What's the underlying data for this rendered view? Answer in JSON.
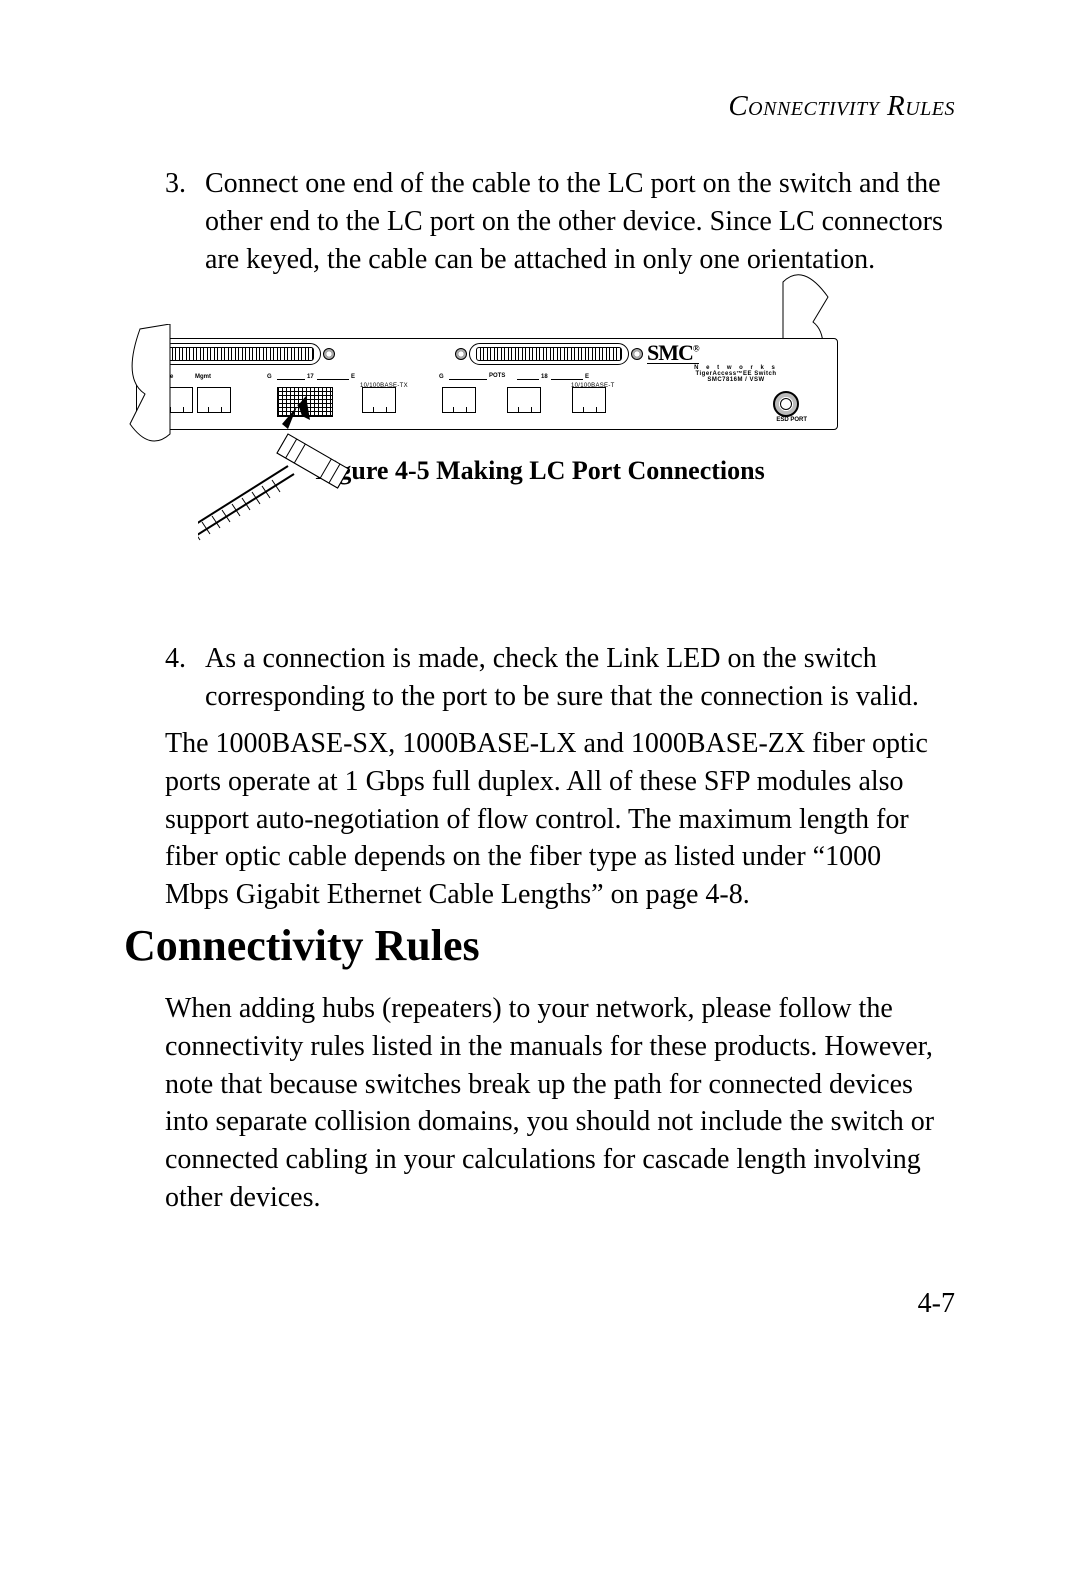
{
  "running_head": "Connectivity Rules",
  "items": {
    "3": {
      "num": "3.",
      "text": "Connect one end of the cable to the LC port on the switch and the other end to the LC port on the other device. Since LC connectors are keyed, the cable can be attached in only one orientation."
    },
    "4": {
      "num": "4.",
      "text": "As a connection is made, check the Link LED on the switch corresponding to the port to be sure that the connection is valid."
    }
  },
  "figure": {
    "caption": "Figure 4-5  Making LC Port Connections",
    "brand": {
      "logo": "SMC",
      "networks": "N e t w o r k s",
      "line3": "TigerAccess™EE Switch",
      "line4": "SMC7816M / VSW"
    },
    "labels": {
      "line": "Line",
      "mgmt": "Mgmt",
      "pots": "POTS",
      "g_left": "G",
      "g_right": "E",
      "num17": "17",
      "num18": "18",
      "esdport": "ESD PORT",
      "eth1": "10/100BASE-TX",
      "eth2": "10/100BASE-T"
    }
  },
  "paraSFP": "The 1000BASE-SX, 1000BASE-LX and 1000BASE-ZX fiber optic ports operate at 1 Gbps full duplex. All of these SFP modules also support auto-negotiation of flow control. The maximum length for fiber optic cable depends on the fiber type as listed under “1000 Mbps Gigabit Ethernet Cable Lengths” on page 4-8.",
  "heading": "Connectivity Rules",
  "paraRules": "When adding hubs (repeaters) to your network, please follow the connectivity rules listed in the manuals for these products. However, note that because switches break up the path for connected devices into separate collision domains, you should not include the switch or connected cabling in your calculations for cascade length involving other devices.",
  "page_number": "4-7"
}
